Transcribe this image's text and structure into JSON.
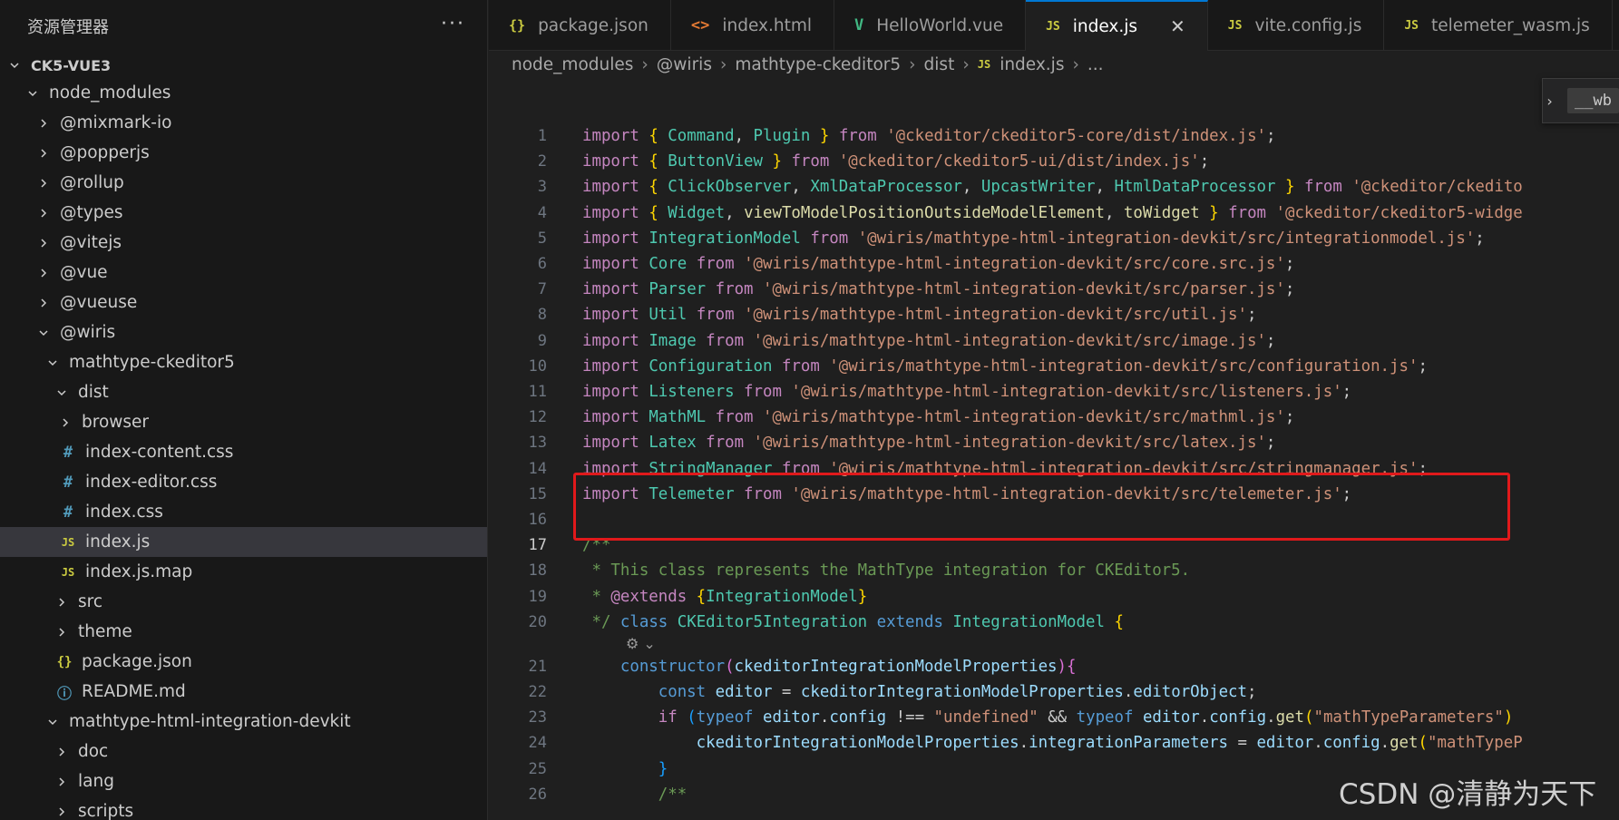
{
  "sidebar": {
    "title": "资源管理器",
    "more": "···",
    "root": "CK5-VUE3",
    "items": [
      {
        "label": "node_modules",
        "type": "folder-open",
        "depth": 0
      },
      {
        "label": "@mixmark-io",
        "type": "folder",
        "depth": 1
      },
      {
        "label": "@popperjs",
        "type": "folder",
        "depth": 1
      },
      {
        "label": "@rollup",
        "type": "folder",
        "depth": 1
      },
      {
        "label": "@types",
        "type": "folder",
        "depth": 1
      },
      {
        "label": "@vitejs",
        "type": "folder",
        "depth": 1
      },
      {
        "label": "@vue",
        "type": "folder",
        "depth": 1
      },
      {
        "label": "@vueuse",
        "type": "folder",
        "depth": 1
      },
      {
        "label": "@wiris",
        "type": "folder-open",
        "depth": 1
      },
      {
        "label": "mathtype-ckeditor5",
        "type": "folder-open",
        "depth": 2
      },
      {
        "label": "dist",
        "type": "folder-open",
        "depth": 3
      },
      {
        "label": "browser",
        "type": "folder",
        "depth": 4
      },
      {
        "label": "index-content.css",
        "type": "css",
        "depth": 4,
        "icon": "#"
      },
      {
        "label": "index-editor.css",
        "type": "css",
        "depth": 4,
        "icon": "#"
      },
      {
        "label": "index.css",
        "type": "css",
        "depth": 4,
        "icon": "#"
      },
      {
        "label": "index.js",
        "type": "js",
        "depth": 4,
        "icon": "JS",
        "selected": true
      },
      {
        "label": "index.js.map",
        "type": "js",
        "depth": 4,
        "icon": "JS"
      },
      {
        "label": "src",
        "type": "folder",
        "depth": 3
      },
      {
        "label": "theme",
        "type": "folder",
        "depth": 3
      },
      {
        "label": "package.json",
        "type": "json",
        "depth": 3,
        "icon": "{}"
      },
      {
        "label": "README.md",
        "type": "info",
        "depth": 3,
        "icon": "ⓘ"
      },
      {
        "label": "mathtype-html-integration-devkit",
        "type": "folder-open",
        "depth": 2
      },
      {
        "label": "doc",
        "type": "folder",
        "depth": 3
      },
      {
        "label": "lang",
        "type": "folder",
        "depth": 3
      },
      {
        "label": "scripts",
        "type": "folder",
        "depth": 3
      }
    ]
  },
  "tabs": [
    {
      "label": "package.json",
      "icon": "{}",
      "type": "json"
    },
    {
      "label": "index.html",
      "icon": "<>",
      "type": "html"
    },
    {
      "label": "HelloWorld.vue",
      "icon": "V",
      "type": "vue"
    },
    {
      "label": "index.js",
      "icon": "JS",
      "type": "js",
      "active": true,
      "close": "✕"
    },
    {
      "label": "vite.config.js",
      "icon": "JS",
      "type": "js"
    },
    {
      "label": "telemeter_wasm.js",
      "icon": "JS",
      "type": "js"
    }
  ],
  "breadcrumb": {
    "parts": [
      "node_modules",
      "@wiris",
      "mathtype-ckeditor5",
      "dist"
    ],
    "file_icon": "JS",
    "file": "index.js",
    "tail": "..."
  },
  "widget": {
    "text": "__wb"
  },
  "editor": {
    "current_line": 17,
    "lines": [
      {
        "n": "1",
        "html": "<span class='k'>import</span> <span class='br1'>{</span> <span class='cls'>Command</span><span class='p'>,</span> <span class='cls'>Plugin</span> <span class='br1'>}</span> <span class='k'>from</span> <span class='s'>'@ckeditor/ckeditor5-core/dist/index.js'</span><span class='p'>;</span>"
      },
      {
        "n": "2",
        "html": "<span class='k'>import</span> <span class='br1'>{</span> <span class='cls'>ButtonView</span> <span class='br1'>}</span> <span class='k'>from</span> <span class='s'>'@ckeditor/ckeditor5-ui/dist/index.js'</span><span class='p'>;</span>"
      },
      {
        "n": "3",
        "html": "<span class='k'>import</span> <span class='br1'>{</span> <span class='cls'>ClickObserver</span><span class='p'>,</span> <span class='cls'>XmlDataProcessor</span><span class='p'>,</span> <span class='cls'>UpcastWriter</span><span class='p'>,</span> <span class='cls'>HtmlDataProcessor</span> <span class='br1'>}</span> <span class='k'>from</span> <span class='s'>'@ckeditor/ckedito</span>"
      },
      {
        "n": "4",
        "html": "<span class='k'>import</span> <span class='br1'>{</span> <span class='cls'>Widget</span><span class='p'>,</span> <span class='fn'>viewToModelPositionOutsideModelElement</span><span class='p'>,</span> <span class='fn'>toWidget</span> <span class='br1'>}</span> <span class='k'>from</span> <span class='s'>'@ckeditor/ckeditor5-widge</span>"
      },
      {
        "n": "5",
        "html": "<span class='k'>import</span> <span class='cls'>IntegrationModel</span> <span class='k'>from</span> <span class='s'>'@wiris/mathtype-html-integration-devkit/src/integrationmodel.js'</span><span class='p'>;</span>"
      },
      {
        "n": "6",
        "html": "<span class='k'>import</span> <span class='cls'>Core</span> <span class='k'>from</span> <span class='s'>'@wiris/mathtype-html-integration-devkit/src/core.src.js'</span><span class='p'>;</span>"
      },
      {
        "n": "7",
        "html": "<span class='k'>import</span> <span class='cls'>Parser</span> <span class='k'>from</span> <span class='s'>'@wiris/mathtype-html-integration-devkit/src/parser.js'</span><span class='p'>;</span>"
      },
      {
        "n": "8",
        "html": "<span class='k'>import</span> <span class='cls'>Util</span> <span class='k'>from</span> <span class='s'>'@wiris/mathtype-html-integration-devkit/src/util.js'</span><span class='p'>;</span>"
      },
      {
        "n": "9",
        "html": "<span class='k'>import</span> <span class='cls'>Image</span> <span class='k'>from</span> <span class='s'>'@wiris/mathtype-html-integration-devkit/src/image.js'</span><span class='p'>;</span>"
      },
      {
        "n": "10",
        "html": "<span class='k'>import</span> <span class='cls'>Configuration</span> <span class='k'>from</span> <span class='s'>'@wiris/mathtype-html-integration-devkit/src/configuration.js'</span><span class='p'>;</span>"
      },
      {
        "n": "11",
        "html": "<span class='k'>import</span> <span class='cls'>Listeners</span> <span class='k'>from</span> <span class='s'>'@wiris/mathtype-html-integration-devkit/src/listeners.js'</span><span class='p'>;</span>"
      },
      {
        "n": "12",
        "html": "<span class='k'>import</span> <span class='cls'>MathML</span> <span class='k'>from</span> <span class='s'>'@wiris/mathtype-html-integration-devkit/src/mathml.js'</span><span class='p'>;</span>"
      },
      {
        "n": "13",
        "html": "<span class='k'>import</span> <span class='cls'>Latex</span> <span class='k'>from</span> <span class='s'>'@wiris/mathtype-html-integration-devkit/src/latex.js'</span><span class='p'>;</span>"
      },
      {
        "n": "14",
        "html": "<span class='k'>import</span> <span class='cls'>StringManager</span> <span class='k'>from</span> <span class='s'>'@wiris/mathtype-html-integration-devkit/src/stringmanager.js'</span><span class='p'>;</span>"
      },
      {
        "n": "15",
        "html": "<span class='k'>import</span> <span class='cls'>Telemeter</span> <span class='k'>from</span> <span class='s'>'@wiris/mathtype-html-integration-devkit/src/telemeter.js'</span><span class='p'>;</span>"
      },
      {
        "n": "16",
        "html": ""
      },
      {
        "n": "17",
        "html": "<span class='c'>/**</span>"
      },
      {
        "n": "18",
        "html": "<span class='c'> * This class represents the MathType integration for CKEditor5.</span>"
      },
      {
        "n": "19",
        "html": "<span class='c'> * </span><span class='k'>@extends</span><span class='c'> </span><span class='br1'>{</span><span class='cls'>IntegrationModel</span><span class='br1'>}</span>"
      },
      {
        "n": "20",
        "html": "<span class='c'> */</span> <span class='kw'>class</span> <span class='cls'>CKEditor5Integration</span> <span class='kw'>extends</span> <span class='cls'>IntegrationModel</span> <span class='br1'>{</span>"
      },
      {
        "n": "21",
        "html": "    <span class='kw'>constructor</span><span class='br2'>(</span><span class='v'>ckeditorIntegrationModelProperties</span><span class='br2'>)</span><span class='br2'>{</span>"
      },
      {
        "n": "22",
        "html": "        <span class='kw'>const</span> <span class='v'>editor</span> <span class='p'>=</span> <span class='v'>ckeditorIntegrationModelProperties</span><span class='p'>.</span><span class='v'>editorObject</span><span class='p'>;</span>"
      },
      {
        "n": "23",
        "html": "        <span class='k'>if</span> <span class='br3'>(</span><span class='kw'>typeof</span> <span class='v'>editor</span><span class='p'>.</span><span class='v'>config</span> <span class='p'>!==</span> <span class='s'>\"undefined\"</span> <span class='p'>&amp;&amp;</span> <span class='kw'>typeof</span> <span class='v'>editor</span><span class='p'>.</span><span class='v'>config</span><span class='p'>.</span><span class='fn'>get</span><span class='br1'>(</span><span class='s'>\"mathTypeParameters\"</span><span class='br1'>)</span>"
      },
      {
        "n": "24",
        "html": "            <span class='v'>ckeditorIntegrationModelProperties</span><span class='p'>.</span><span class='v'>integrationParameters</span> <span class='p'>=</span> <span class='v'>editor</span><span class='p'>.</span><span class='v'>config</span><span class='p'>.</span><span class='fn'>get</span><span class='br1'>(</span><span class='s'>\"mathTypeP</span>"
      },
      {
        "n": "25",
        "html": "        <span class='br3'>}</span>"
      },
      {
        "n": "26",
        "html": "        <span class='c'>/**</span>"
      }
    ]
  },
  "codelens": "⚙ ⌄",
  "watermark": "CSDN @清静为天下"
}
